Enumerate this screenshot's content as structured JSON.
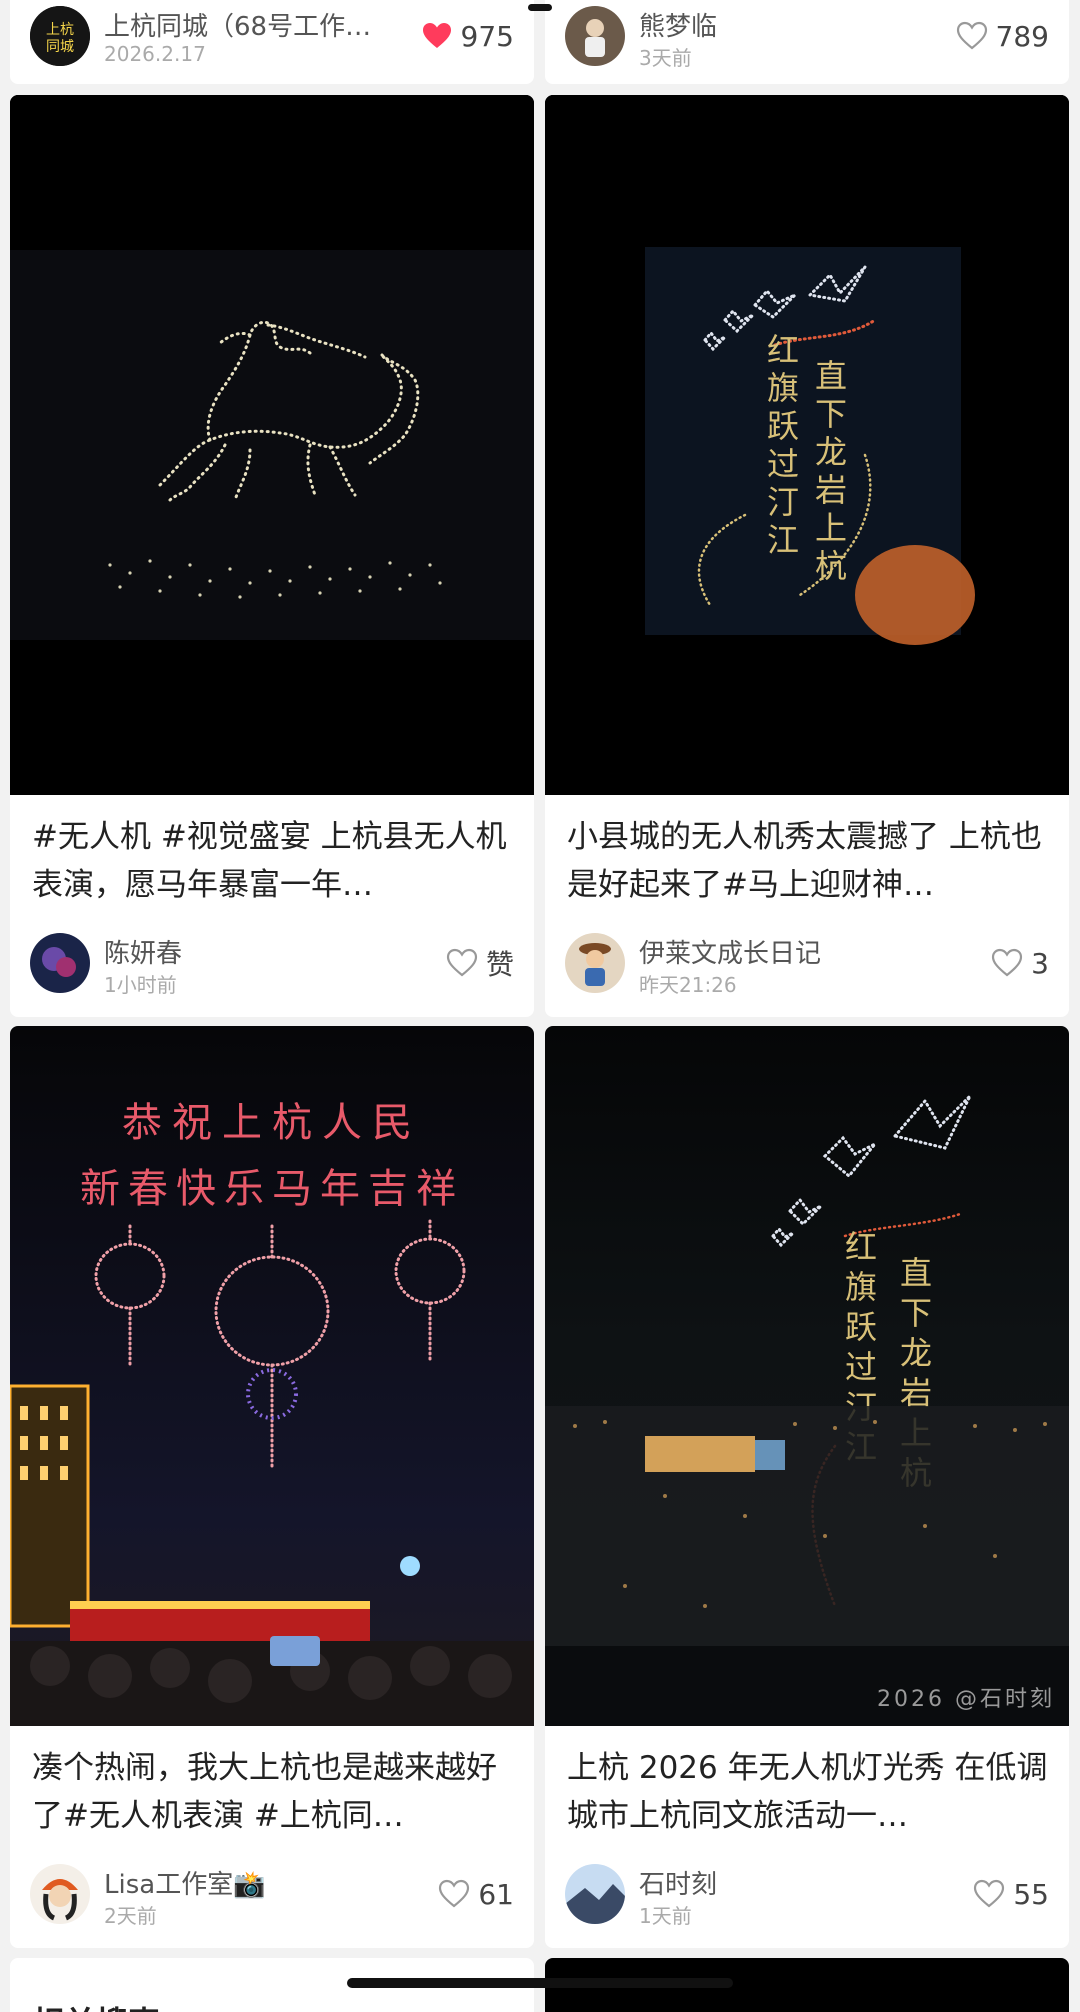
{
  "cards": [
    {
      "author": "上杭同城（68号工作…",
      "time": "2026.2.17",
      "likes": "975",
      "liked": true
    },
    {
      "author": "熊梦临",
      "time": "3天前",
      "likes": "789",
      "liked": false
    },
    {
      "title": "#无人机 #视觉盛宴 上杭县无人机表演，愿马年暴富一年…",
      "author": "陈妍春",
      "time": "1小时前",
      "likes": "赞",
      "liked": false
    },
    {
      "title": "小县城的无人机秀太震撼了 上杭也是好起来了#马上迎财神…",
      "author": "伊莱文成长日记",
      "time": "昨天21:26",
      "likes": "3",
      "liked": false
    },
    {
      "title": "凑个热闹，我大上杭也是越来越好了#无人机表演 #上杭同…",
      "author": "Lisa工作室📸",
      "time": "2天前",
      "likes": "61",
      "liked": false
    },
    {
      "title": "上杭 2026 年无人机灯光秀 在低调城市上杭同文旅活动一…",
      "author": "石时刻",
      "time": "1天前",
      "likes": "55",
      "liked": false
    }
  ],
  "images": {
    "avatar_logo_text": "上杭同城",
    "drone_text_col1": [
      "红",
      "旗",
      "跃",
      "过",
      "汀",
      "江"
    ],
    "drone_text_col2": [
      "直",
      "下",
      "龙",
      "岩",
      "上",
      "杭"
    ],
    "banner_line1": "恭祝上杭人民",
    "banner_line2": "新春快乐马年吉祥",
    "watermark": "2026 @石时刻"
  },
  "next_section_title": "相关搜索",
  "colors": {
    "liked_heart": "#ff3b5c",
    "heart_outline": "#999999",
    "background": "#f2f2f2"
  }
}
